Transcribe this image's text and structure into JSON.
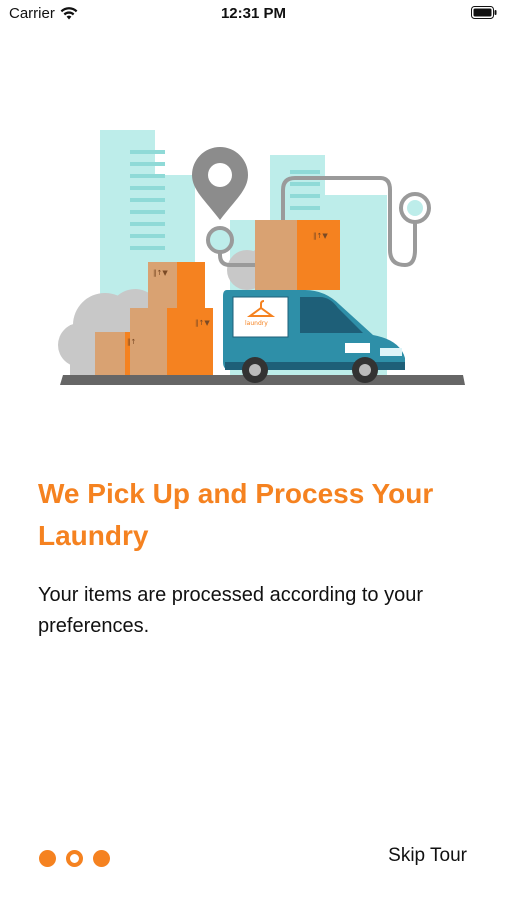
{
  "status_bar": {
    "carrier": "Carrier",
    "time": "12:31 PM",
    "icons": [
      "wifi-icon",
      "battery-icon"
    ]
  },
  "illustration": {
    "van_logo_text": "laundry",
    "icons": [
      "location-pin-icon",
      "delivery-van-icon",
      "hanger-icon"
    ]
  },
  "onboarding": {
    "title": "We Pick Up and Process Your Laundry",
    "description": "Your items are processed according to your preferences."
  },
  "pager": {
    "total": 3,
    "current": 1
  },
  "skip_label": "Skip Tour",
  "colors": {
    "accent": "#F58220",
    "van": "#2E8FA8",
    "city": "#BDEDEA",
    "box": "#D9A272",
    "cloud": "#C8C8C8"
  }
}
